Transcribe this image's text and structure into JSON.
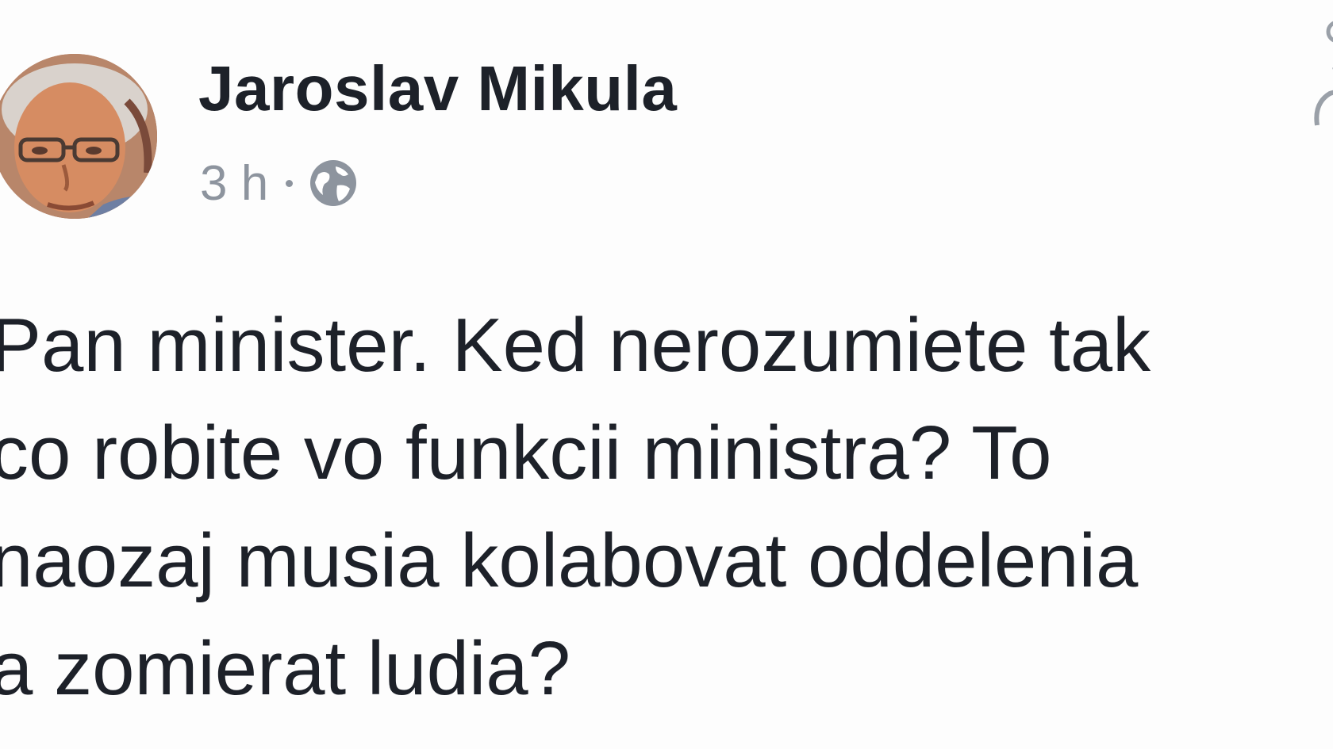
{
  "author": {
    "name": "Jaroslav Mikula",
    "avatar_icon": "profile-photo"
  },
  "meta": {
    "time": "3 h",
    "audience_icon": "globe-icon"
  },
  "post": {
    "lines": [
      "Pan minister. Ked nerozumiete tak",
      "co robite vo funkcii ministra? To",
      "naozaj musia kolabovat oddelenia",
      "a zomierat ludia?"
    ]
  },
  "colors": {
    "text": "#1d2129",
    "meta": "#8d949e",
    "background": "#ffffff"
  }
}
